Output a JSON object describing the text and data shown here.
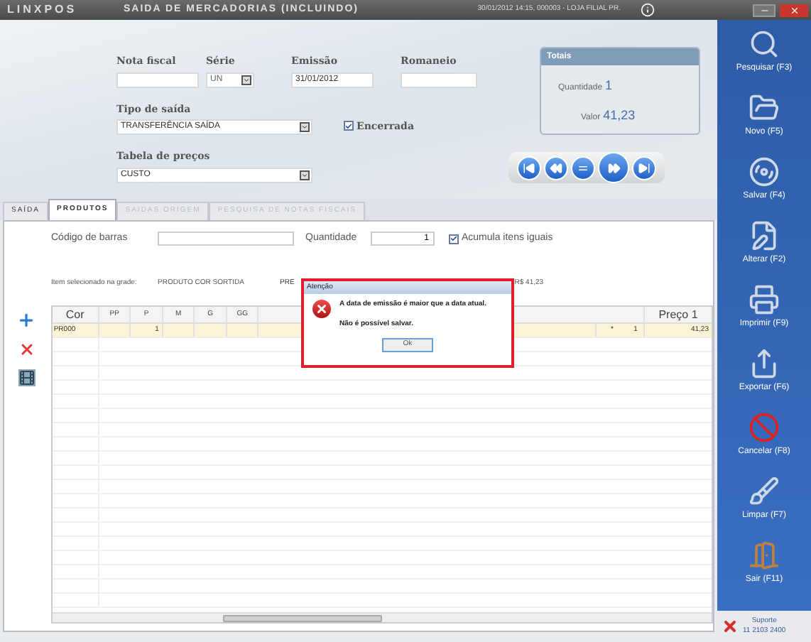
{
  "titlebar": {
    "logo": "LINXPOS",
    "title": "SAIDA DE MERCADORIAS (INCLUINDO)",
    "info": "30/01/2012 14:15, 000003 - LOJA FILIAL PR."
  },
  "form": {
    "nota_fiscal": {
      "label": "Nota fiscal"
    },
    "serie": {
      "label": "Série",
      "value": "UN"
    },
    "emissao": {
      "label": "Emissão",
      "value": "31/01/2012"
    },
    "romaneio": {
      "label": "Romaneio"
    },
    "tipo_saida": {
      "label": "Tipo de saída",
      "value": "TRANSFERÊNCIA SAÍDA"
    },
    "encerrada": {
      "label": "Encerrada",
      "checked": true
    },
    "tabela_precos": {
      "label": "Tabela de preços",
      "value": "CUSTO"
    }
  },
  "totals": {
    "title": "Totais",
    "quantidade_label": "Quantidade",
    "quantidade": "1",
    "valor_label": "Valor",
    "valor": "41,23"
  },
  "tabs": [
    {
      "label": "SAÍDA",
      "selected": false,
      "disabled": false
    },
    {
      "label": "PRODUTOS",
      "selected": true,
      "disabled": false
    },
    {
      "label": "SAIDAS ORIGEM",
      "selected": false,
      "disabled": true
    },
    {
      "label": "PESQUISA DE NOTAS FISCAIS",
      "selected": false,
      "disabled": true
    }
  ],
  "produtos": {
    "barcode_label": "Código de barras",
    "quantidade_label": "Quantidade",
    "quantidade": "1",
    "acumula": {
      "label": "Acumula itens iguais",
      "checked": true
    },
    "item_label": "Item selecionado na grade:",
    "item_name": "PRODUTO COR SORTIDA",
    "item_price_label": "PRE",
    "item_price": "R$ 41,23"
  },
  "grid": {
    "columns": [
      "Cor",
      "PP",
      "P",
      "M",
      "G",
      "GG"
    ],
    "price_column": "Preço 1",
    "rows": [
      {
        "cor": "PR000",
        "sizes": [
          {
            "kind": "empty"
          },
          {
            "kind": "qty",
            "value": "1"
          },
          {
            "kind": "empty"
          },
          {
            "kind": "empty"
          },
          {
            "kind": "empty"
          }
        ],
        "mark": "*",
        "total": "1",
        "price": "41,23",
        "selected": true
      }
    ]
  },
  "dialog": {
    "title": "Atenção",
    "lines": [
      "A data de emissão é maior que a data atual.",
      "Não é possível salvar."
    ],
    "button": "Ok"
  },
  "sidebar": [
    {
      "kind": "search",
      "label": "Pesquisar (F3)"
    },
    {
      "kind": "new",
      "label": "Novo (F5)"
    },
    {
      "kind": "save",
      "label": "Salvar (F4)"
    },
    {
      "kind": "edit",
      "label": "Alterar (F2)"
    },
    {
      "kind": "print",
      "label": "Imprimir (F9)"
    },
    {
      "kind": "export",
      "label": "Exportar (F6)"
    },
    {
      "kind": "cancel",
      "label": "Cancelar (F8)"
    },
    {
      "kind": "clear",
      "label": "Limpar (F7)"
    },
    {
      "kind": "exit",
      "label": "Sair (F11)"
    }
  ],
  "support": {
    "label": "Suporte",
    "phone": "11 2103 2400"
  }
}
